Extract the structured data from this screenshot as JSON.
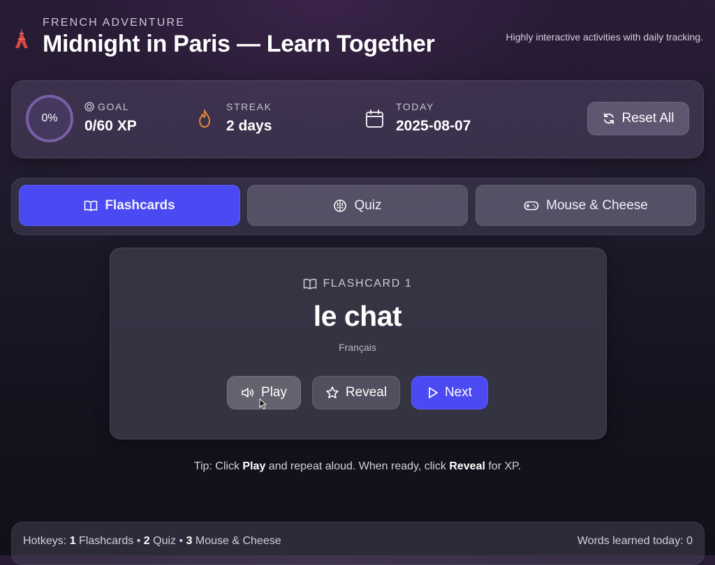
{
  "header": {
    "eyebrow": "FRENCH ADVENTURE",
    "title": "Midnight in Paris — Learn Together",
    "subtitle": "Highly interactive activities with daily tracking.",
    "logo_icon": "eiffel-tower-icon"
  },
  "stats": {
    "progress_percent": "0%",
    "goal": {
      "label": "GOAL",
      "value": "0/60 XP",
      "icon": "target-icon"
    },
    "streak": {
      "label": "STREAK",
      "value": "2 days",
      "icon": "flame-icon"
    },
    "today": {
      "label": "TODAY",
      "value": "2025-08-07",
      "icon": "calendar-icon"
    },
    "reset_label": "Reset All"
  },
  "tabs": [
    {
      "label": "Flashcards",
      "icon": "book-icon",
      "active": true
    },
    {
      "label": "Quiz",
      "icon": "brain-icon",
      "active": false
    },
    {
      "label": "Mouse & Cheese",
      "icon": "gamepad-icon",
      "active": false
    }
  ],
  "flashcard": {
    "label": "FLASHCARD 1",
    "word": "le chat",
    "language": "Français",
    "buttons": {
      "play": "Play",
      "reveal": "Reveal",
      "next": "Next"
    }
  },
  "tip": {
    "prefix": "Tip: Click ",
    "play": "Play",
    "middle": " and repeat aloud. When ready, click ",
    "reveal": "Reveal",
    "suffix": " for XP."
  },
  "footer": {
    "hotkeys_prefix": "Hotkeys: ",
    "key1": "1",
    "label1": " Flashcards • ",
    "key2": "2",
    "label2": " Quiz • ",
    "key3": "3",
    "label3": " Mouse & Cheese",
    "words_learned": "Words learned today: 0"
  },
  "colors": {
    "accent": "#4b4af2",
    "flame": "#e8873a",
    "ring": "#7a5fa8"
  }
}
